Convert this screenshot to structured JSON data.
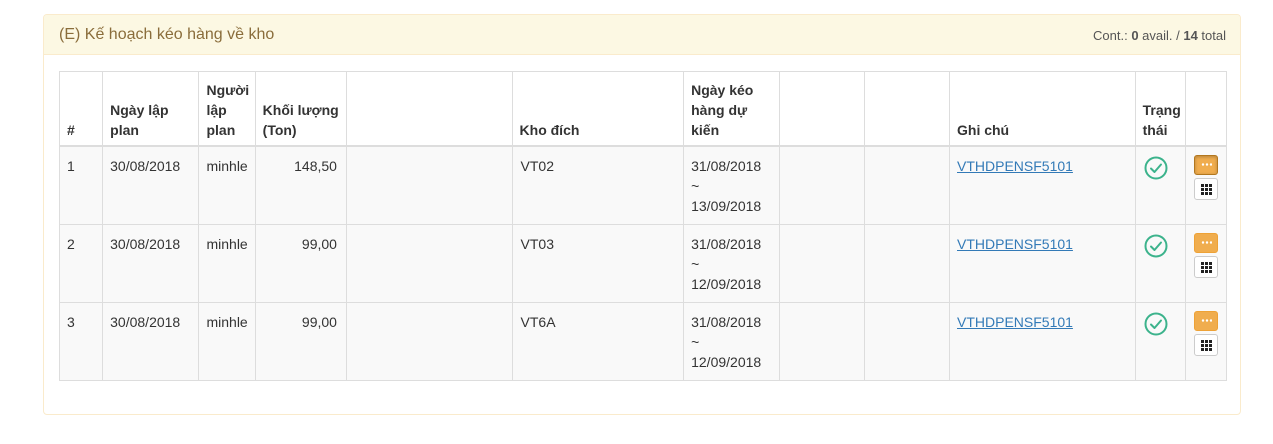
{
  "panel": {
    "title": "(E) Kế hoạch kéo hàng về kho",
    "count_prefix": "Cont.: ",
    "avail": "0",
    "avail_suffix": " avail. / ",
    "total": "14",
    "total_suffix": " total"
  },
  "table": {
    "headers": {
      "index": "#",
      "created_date": "Ngày lập plan",
      "creator": "Người lập plan",
      "weight": "Khối lượng (Ton)",
      "blank1": "",
      "warehouse": "Kho đích",
      "pull_date": "Ngày kéo hàng dự kiến",
      "blank2": "",
      "blank3": "",
      "note": "Ghi chú",
      "status": "Trạng thái",
      "actions": ""
    },
    "rows": [
      {
        "index": "1",
        "created_date": "30/08/2018",
        "creator": "minhle",
        "weight": "148,50",
        "warehouse": "VT02",
        "pull_from": "31/08/2018",
        "pull_sep": "~",
        "pull_to": "13/09/2018",
        "note": "VTHDPENSF5101",
        "status_icon": "check-circle-icon"
      },
      {
        "index": "2",
        "created_date": "30/08/2018",
        "creator": "minhle",
        "weight": "99,00",
        "warehouse": "VT03",
        "pull_from": "31/08/2018",
        "pull_sep": "~",
        "pull_to": "12/09/2018",
        "note": "VTHDPENSF5101",
        "status_icon": "check-circle-icon"
      },
      {
        "index": "3",
        "created_date": "30/08/2018",
        "creator": "minhle",
        "weight": "99,00",
        "warehouse": "VT6A",
        "pull_from": "31/08/2018",
        "pull_sep": "~",
        "pull_to": "12/09/2018",
        "note": "VTHDPENSF5101",
        "status_icon": "check-circle-icon"
      }
    ]
  },
  "colors": {
    "panel_heading_bg": "#fcf8e3",
    "panel_border": "#faebcc",
    "title_text": "#8a6d3b",
    "link": "#337ab7",
    "status_ok": "#3cb38c",
    "menu_button": "#f0ad4e"
  }
}
